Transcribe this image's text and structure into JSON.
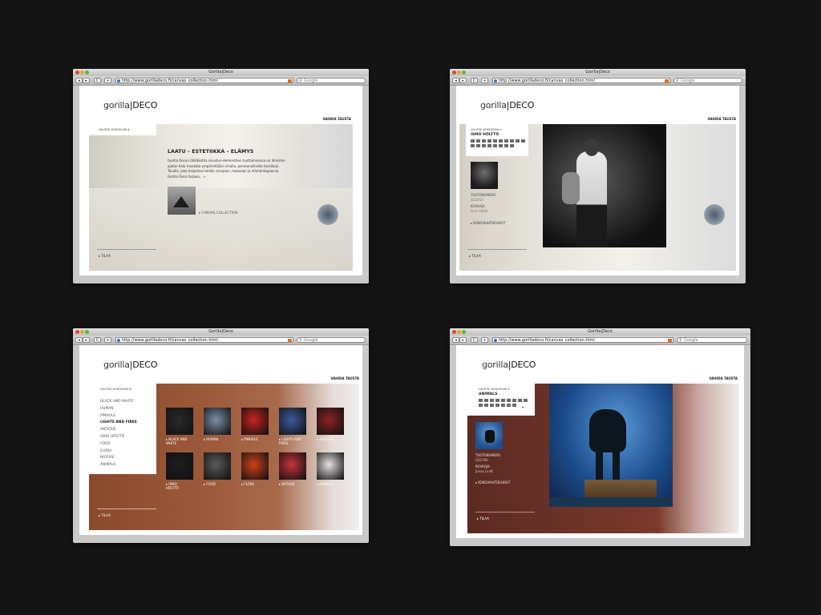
{
  "browser": {
    "title": "Gorilla|Deco",
    "url": "http://www.gorilladeco.fi/canvas_collection.html",
    "search_placeholder": "Google",
    "back": "◂",
    "forward": "▸",
    "reload": "C",
    "add": "+"
  },
  "site": {
    "logo_prefix": "gorilla",
    "logo_suffix": "|DECO",
    "vaihda": "VAIHDA TAUSTA",
    "tilaa": "▸ TILAA"
  },
  "screen1": {
    "menu_label": "VALITSE KOKOELMA ▾",
    "heading": "LAATU – ESTETIIKKA – ELÄMYS",
    "body": "Gorilla Decon lähtökohta sisustus-elementtien tuottamisessa on ihmisten ajaton halu muokata ympäristöään omalla, persoonallisella tavallaan. Tavalla, joka heijastaa heidän arvojaan, makuaan ja elämäntapaansa. Gorilla Deco tarjoaa... »",
    "link": "▸ CANVAS COLLECTION"
  },
  "screen2": {
    "menu_label": "VALITSE KOKOELMA ▾",
    "collection": "ISMO HÖLTTÖ",
    "product_label": "TUOTENUMERO",
    "product_no": "GS2010",
    "kuvaaja_label": "KUVAAJA:",
    "kuvaaja": "Ismo Höltö",
    "kokovaihtoehdot": "▸ KOKOVAIHTOEHDOT"
  },
  "screen3": {
    "menu_label": "VALITSE KOKOELMA ▾",
    "categories": [
      "BLACK AND WHITE",
      "HUMAN",
      "PINHOLE",
      "LIGHTS AND FIRES",
      "ANTIQUE",
      "ISMO HÖLTTÖ",
      "FOOD",
      "FLORA",
      "NATURE",
      "ANIMALS"
    ],
    "active_category": "LIGHTS AND FIRES",
    "thumbs": [
      {
        "label": "▸ BLACK AND\nWHITE",
        "color": "#2a2a2a"
      },
      {
        "label": "▸ HUMAN",
        "color": "#7b8fa6"
      },
      {
        "label": "▸ PINHOLE",
        "color": "#c92320"
      },
      {
        "label": "▸ LIGHTS AND\nFIRES",
        "color": "#3b5a9a"
      },
      {
        "label": "▸ ANTIQUE",
        "color": "#8c2222"
      },
      {
        "label": "▸ ISMO\nHÖLTTÖ",
        "color": "#1d1d1d"
      },
      {
        "label": "▸ FOOD",
        "color": "#5a5a5a"
      },
      {
        "label": "▸ FLORA",
        "color": "#d2401c"
      },
      {
        "label": "▸ NATURE",
        "color": "#c9323c"
      },
      {
        "label": "▸ ANIMALS",
        "color": "#e8e0e4"
      }
    ]
  },
  "screen4": {
    "menu_label": "VALITSE KOKOELMA ▾",
    "collection": "ANIMALS",
    "product_label": "TUOTENUMERO",
    "product_no": "GS1390",
    "kuvaaja_label": "KUVAAJA:",
    "kuvaaja": "Jonas Lindt",
    "kokovaihtoehdot": "▸ KOKOVAIHTOEHDOT",
    "arrow": "▸"
  }
}
